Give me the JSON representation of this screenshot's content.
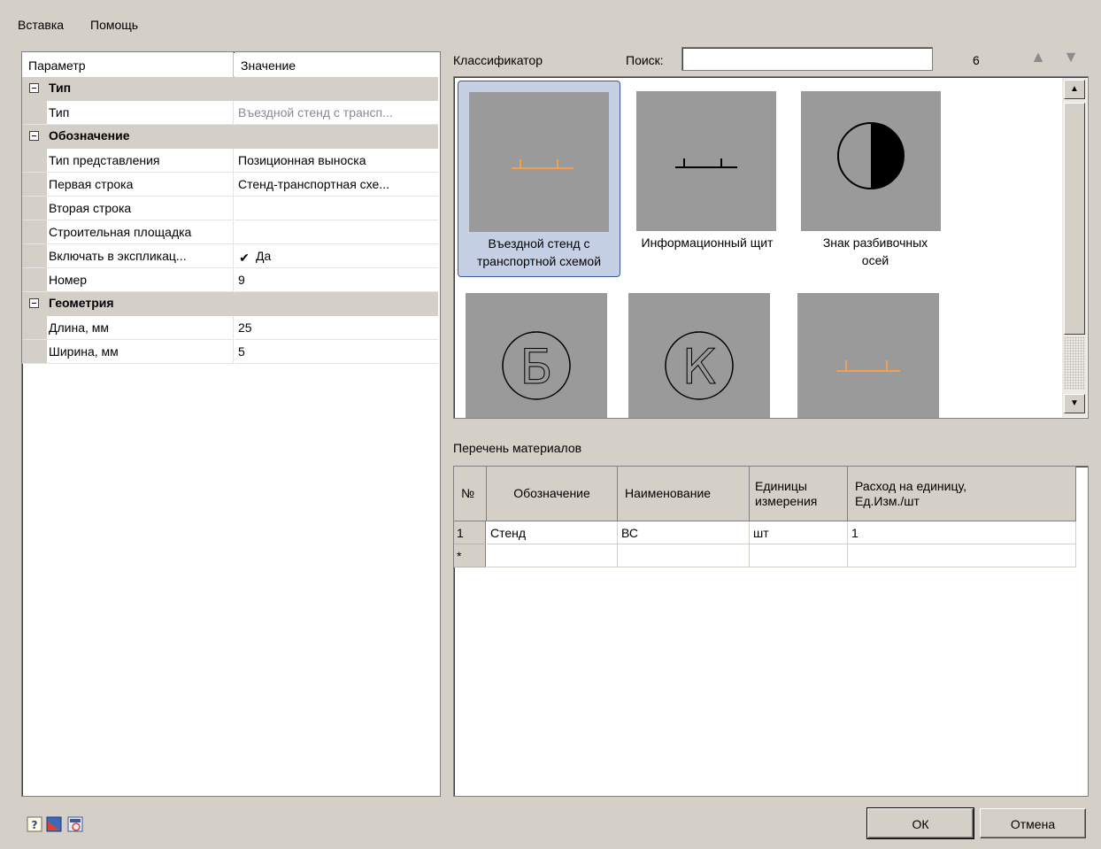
{
  "menu": {
    "items": [
      "Вставка",
      "Помощь"
    ]
  },
  "properties": {
    "headers": {
      "param": "Параметр",
      "value": "Значение"
    },
    "rows": [
      {
        "kind": "cat",
        "label": "Тип"
      },
      {
        "kind": "prop",
        "name": "Тип",
        "value": "Въездной стенд с трансп...",
        "muted": true
      },
      {
        "kind": "cat",
        "label": "Обозначение"
      },
      {
        "kind": "prop",
        "name": "Тип представления",
        "value": "Позиционная выноска"
      },
      {
        "kind": "prop",
        "name": "Первая строка",
        "value": "Стенд-транспортная схе..."
      },
      {
        "kind": "prop",
        "name": "Вторая строка",
        "value": ""
      },
      {
        "kind": "prop",
        "name": "Строительная площадка",
        "value": ""
      },
      {
        "kind": "prop",
        "name": "Включать в экспликац...",
        "value": "Да",
        "checkbox": true
      },
      {
        "kind": "prop",
        "name": "Номер",
        "value": "9"
      },
      {
        "kind": "cat",
        "label": "Геометрия"
      },
      {
        "kind": "prop",
        "name": "Длина, мм",
        "value": "25"
      },
      {
        "kind": "prop",
        "name": "Ширина, мм",
        "value": "5"
      }
    ]
  },
  "classifier": {
    "label": "Классификатор",
    "search_label": "Поиск:",
    "search_value": "",
    "count": "6",
    "items": [
      {
        "label_line1": "Въездной стенд с",
        "label_line2": "транспортной схемой",
        "icon": "stand-orange-symbol",
        "selected": true
      },
      {
        "label_line1": "Информационный щит",
        "label_line2": "",
        "icon": "stand-black-symbol"
      },
      {
        "label_line1": "Знак разбивочных",
        "label_line2": "осей",
        "icon": "half-filled-circle-symbol"
      },
      {
        "label_line1": "",
        "label_line2": "",
        "icon": "circle-letter-b-symbol",
        "glyph": "Б"
      },
      {
        "label_line1": "",
        "label_line2": "",
        "icon": "circle-letter-k-symbol",
        "glyph": "К"
      },
      {
        "label_line1": "",
        "label_line2": "",
        "icon": "stand-orange-symbol"
      }
    ]
  },
  "materials": {
    "label": "Перечень материалов",
    "columns": [
      "№",
      "Обозначение",
      "Наименование",
      "Единицы измерения",
      "Расход на единицу, Ед.Изм./шт"
    ],
    "column_lines": [
      [
        "№"
      ],
      [
        "Обозначение"
      ],
      [
        "Наименование"
      ],
      [
        "Единицы",
        "измерения"
      ],
      [
        "Расход на единицу,",
        "Ед.Изм./шт"
      ]
    ],
    "rows": [
      {
        "num": "1",
        "designation": "Стенд",
        "name": "ВС",
        "unit": "шт",
        "rate": "1"
      }
    ],
    "new_row_marker": "*"
  },
  "buttons": {
    "ok": "ОК",
    "cancel": "Отмена"
  },
  "colors": {
    "accent_orange": "#f0a050",
    "selection_bg": "#c6d0e4",
    "selection_border": "#3c5a9a"
  }
}
